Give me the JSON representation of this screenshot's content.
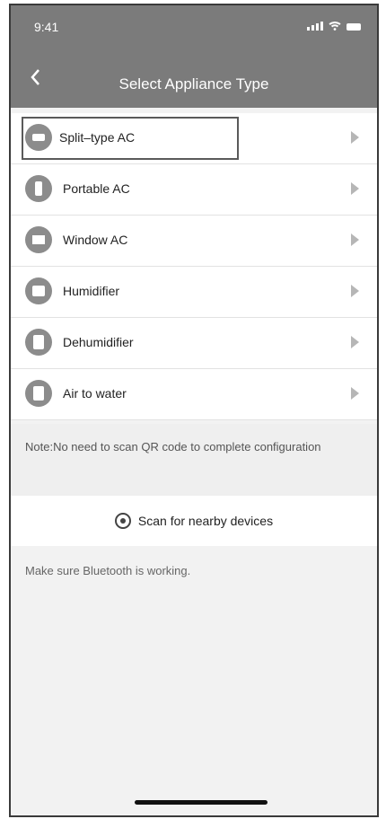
{
  "status": {
    "time": "9:41"
  },
  "header": {
    "title": "Select Appliance Type"
  },
  "appliances": [
    {
      "label": "Split–type AC",
      "icon": "split-ac-icon"
    },
    {
      "label": "Portable AC",
      "icon": "portable-ac-icon"
    },
    {
      "label": "Window AC",
      "icon": "window-ac-icon"
    },
    {
      "label": "Humidifier",
      "icon": "humidifier-icon"
    },
    {
      "label": "Dehumidifier",
      "icon": "dehumidifier-icon"
    },
    {
      "label": "Air to water",
      "icon": "air-to-water-icon"
    }
  ],
  "note": {
    "text": "Note:No need to scan QR code to complete configuration"
  },
  "scan": {
    "label": "Scan for nearby devices"
  },
  "hint": {
    "text": "Make sure Bluetooth is working."
  },
  "colors": {
    "header": "#7b7b7b",
    "background": "#f2f2f2",
    "icon": "#8c8c8c"
  }
}
